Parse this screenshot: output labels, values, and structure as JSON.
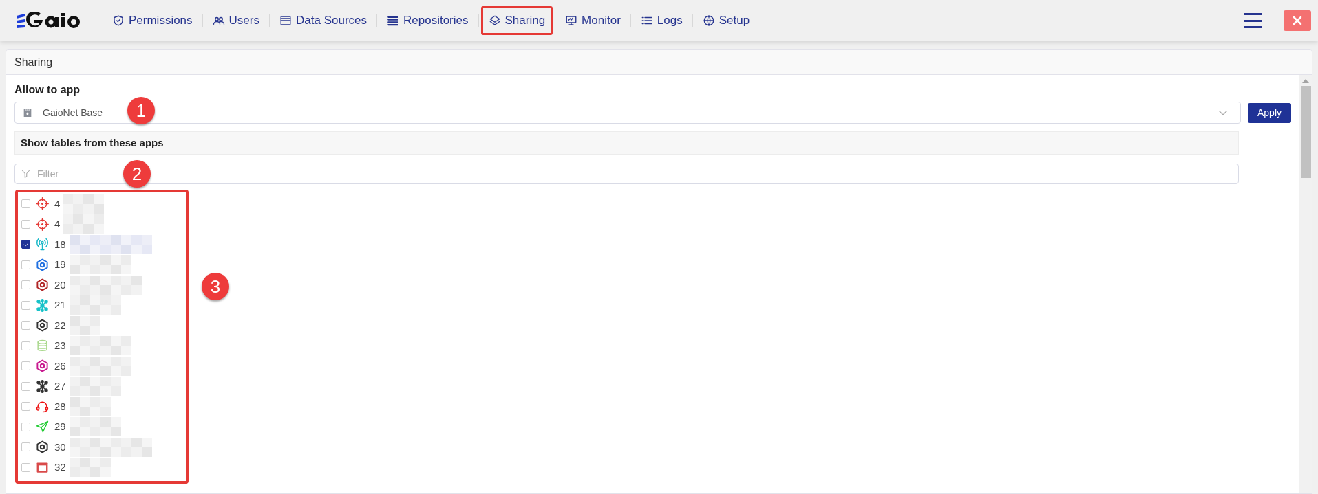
{
  "nav": {
    "items": [
      {
        "label": "Permissions",
        "selected": false
      },
      {
        "label": "Users",
        "selected": false
      },
      {
        "label": "Data Sources",
        "selected": false
      },
      {
        "label": "Repositories",
        "selected": false
      },
      {
        "label": "Sharing",
        "selected": true
      },
      {
        "label": "Monitor",
        "selected": false
      },
      {
        "label": "Logs",
        "selected": false
      },
      {
        "label": "Setup",
        "selected": false
      }
    ]
  },
  "panel": {
    "title": "Sharing",
    "allow_label": "Allow to app",
    "app_select": {
      "value": "GaioNet Base"
    },
    "apply_button": "Apply",
    "apps_heading": "Show tables from these apps",
    "filter": {
      "placeholder": "Filter"
    },
    "apps": [
      {
        "number": "4",
        "kind": "crosshair",
        "color": "#e53935",
        "checked": false
      },
      {
        "number": "4",
        "kind": "crosshair",
        "color": "#e53935",
        "checked": false
      },
      {
        "number": "18",
        "kind": "antenna",
        "color": "#17b8c8",
        "checked": true
      },
      {
        "number": "19",
        "kind": "hexagon",
        "color": "#1e6fe0",
        "checked": false
      },
      {
        "number": "20",
        "kind": "hexagon",
        "color": "#b02424",
        "checked": false
      },
      {
        "number": "21",
        "kind": "network",
        "color": "#17c2c8",
        "checked": false
      },
      {
        "number": "22",
        "kind": "hexagon",
        "color": "#333333",
        "checked": false
      },
      {
        "number": "23",
        "kind": "database",
        "color": "#a9d88c",
        "checked": false
      },
      {
        "number": "26",
        "kind": "hexagon",
        "color": "#c8198f",
        "checked": false
      },
      {
        "number": "27",
        "kind": "network",
        "color": "#333333",
        "checked": false
      },
      {
        "number": "28",
        "kind": "headset",
        "color": "#ee1111",
        "checked": false
      },
      {
        "number": "29",
        "kind": "plane",
        "color": "#22cc33",
        "checked": false
      },
      {
        "number": "30",
        "kind": "hexagon",
        "color": "#333333",
        "checked": false
      },
      {
        "number": "32",
        "kind": "window",
        "color": "#d94a4a",
        "checked": false
      }
    ]
  },
  "annotations": [
    "1",
    "2",
    "3"
  ]
}
